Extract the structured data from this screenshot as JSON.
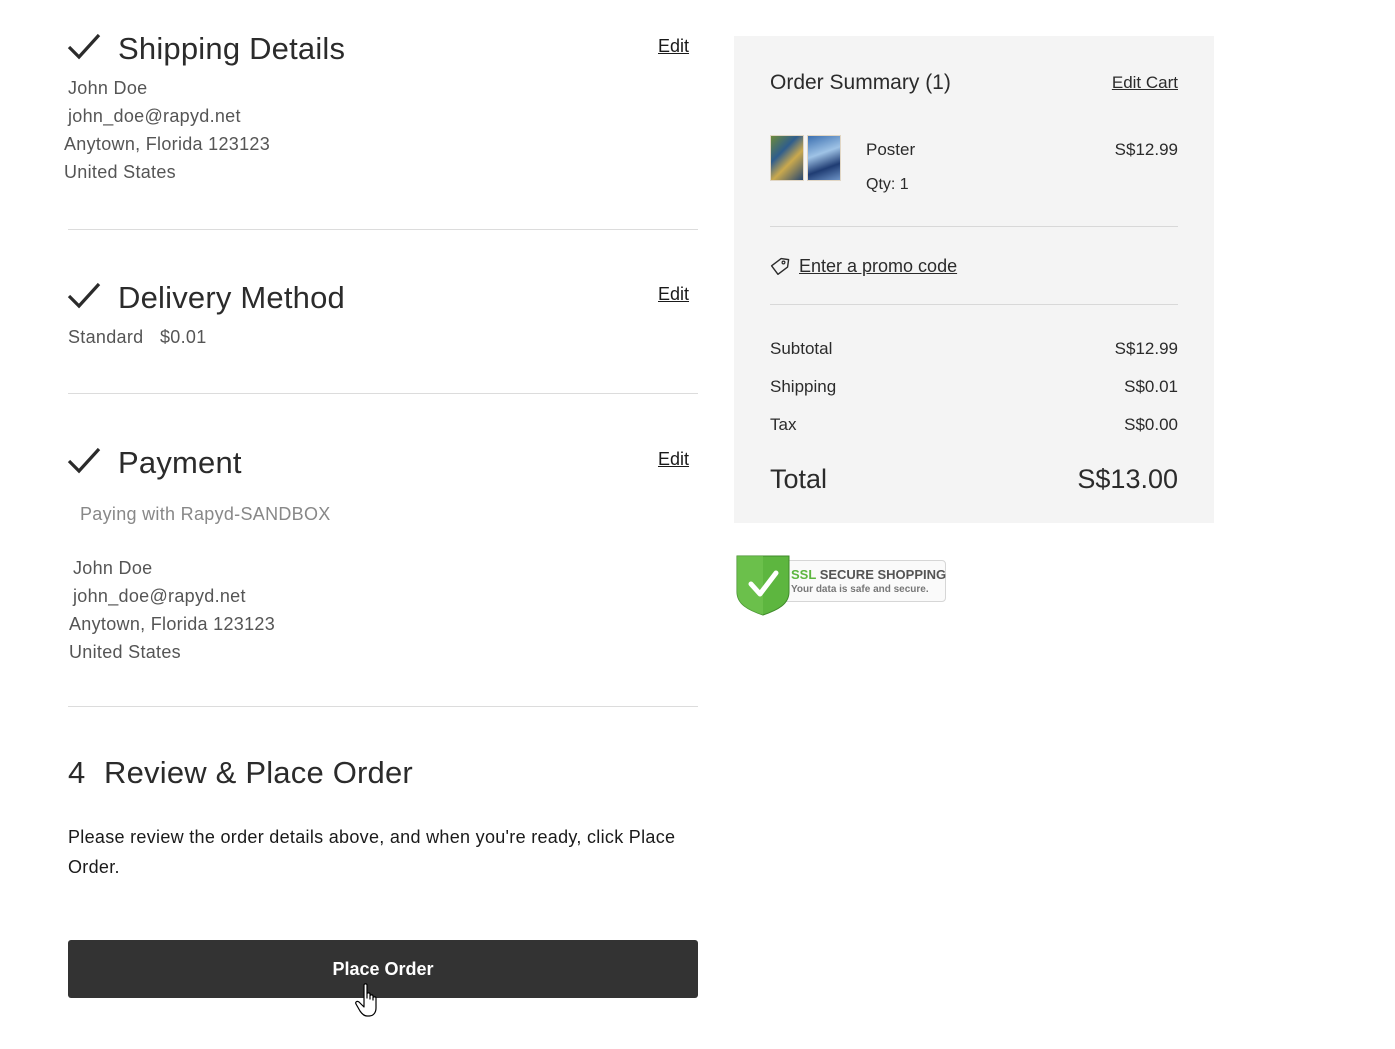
{
  "shipping": {
    "title": "Shipping Details",
    "edit": "Edit",
    "name": "John Doe",
    "email": "john_doe@rapyd.net",
    "address": "Anytown, Florida 123123",
    "country": "United States"
  },
  "delivery": {
    "title": "Delivery Method",
    "edit": "Edit",
    "method": "Standard",
    "price": "$0.01"
  },
  "payment": {
    "title": "Payment",
    "edit": "Edit",
    "provider_text": "Paying with Rapyd-SANDBOX",
    "name": "John Doe",
    "email": "john_doe@rapyd.net",
    "address": "Anytown, Florida 123123",
    "country": "United States"
  },
  "review": {
    "step": "4",
    "title": "Review & Place Order",
    "text": "Please review the order details above, and when you're ready, click Place Order.",
    "button": "Place Order"
  },
  "summary": {
    "title": "Order Summary (1)",
    "edit_cart": "Edit Cart",
    "item": {
      "name": "Poster",
      "qty": "Qty: 1",
      "price": "S$12.99"
    },
    "promo": "Enter a promo code",
    "subtotal_label": "Subtotal",
    "subtotal": "S$12.99",
    "shipping_label": "Shipping",
    "shipping": "S$0.01",
    "tax_label": "Tax",
    "tax": "S$0.00",
    "total_label": "Total",
    "total": "S$13.00"
  },
  "ssl_badge": {
    "ssl": "SSL",
    "title": "SECURE SHOPPING",
    "subtitle": "Your data is safe and secure."
  },
  "colors": {
    "button_bg": "#333333",
    "summary_bg": "#f4f4f4",
    "badge_green": "#5db63f"
  },
  "icons": [
    "check-icon",
    "tag-icon",
    "ssl-shield-icon",
    "hand-cursor-icon"
  ]
}
